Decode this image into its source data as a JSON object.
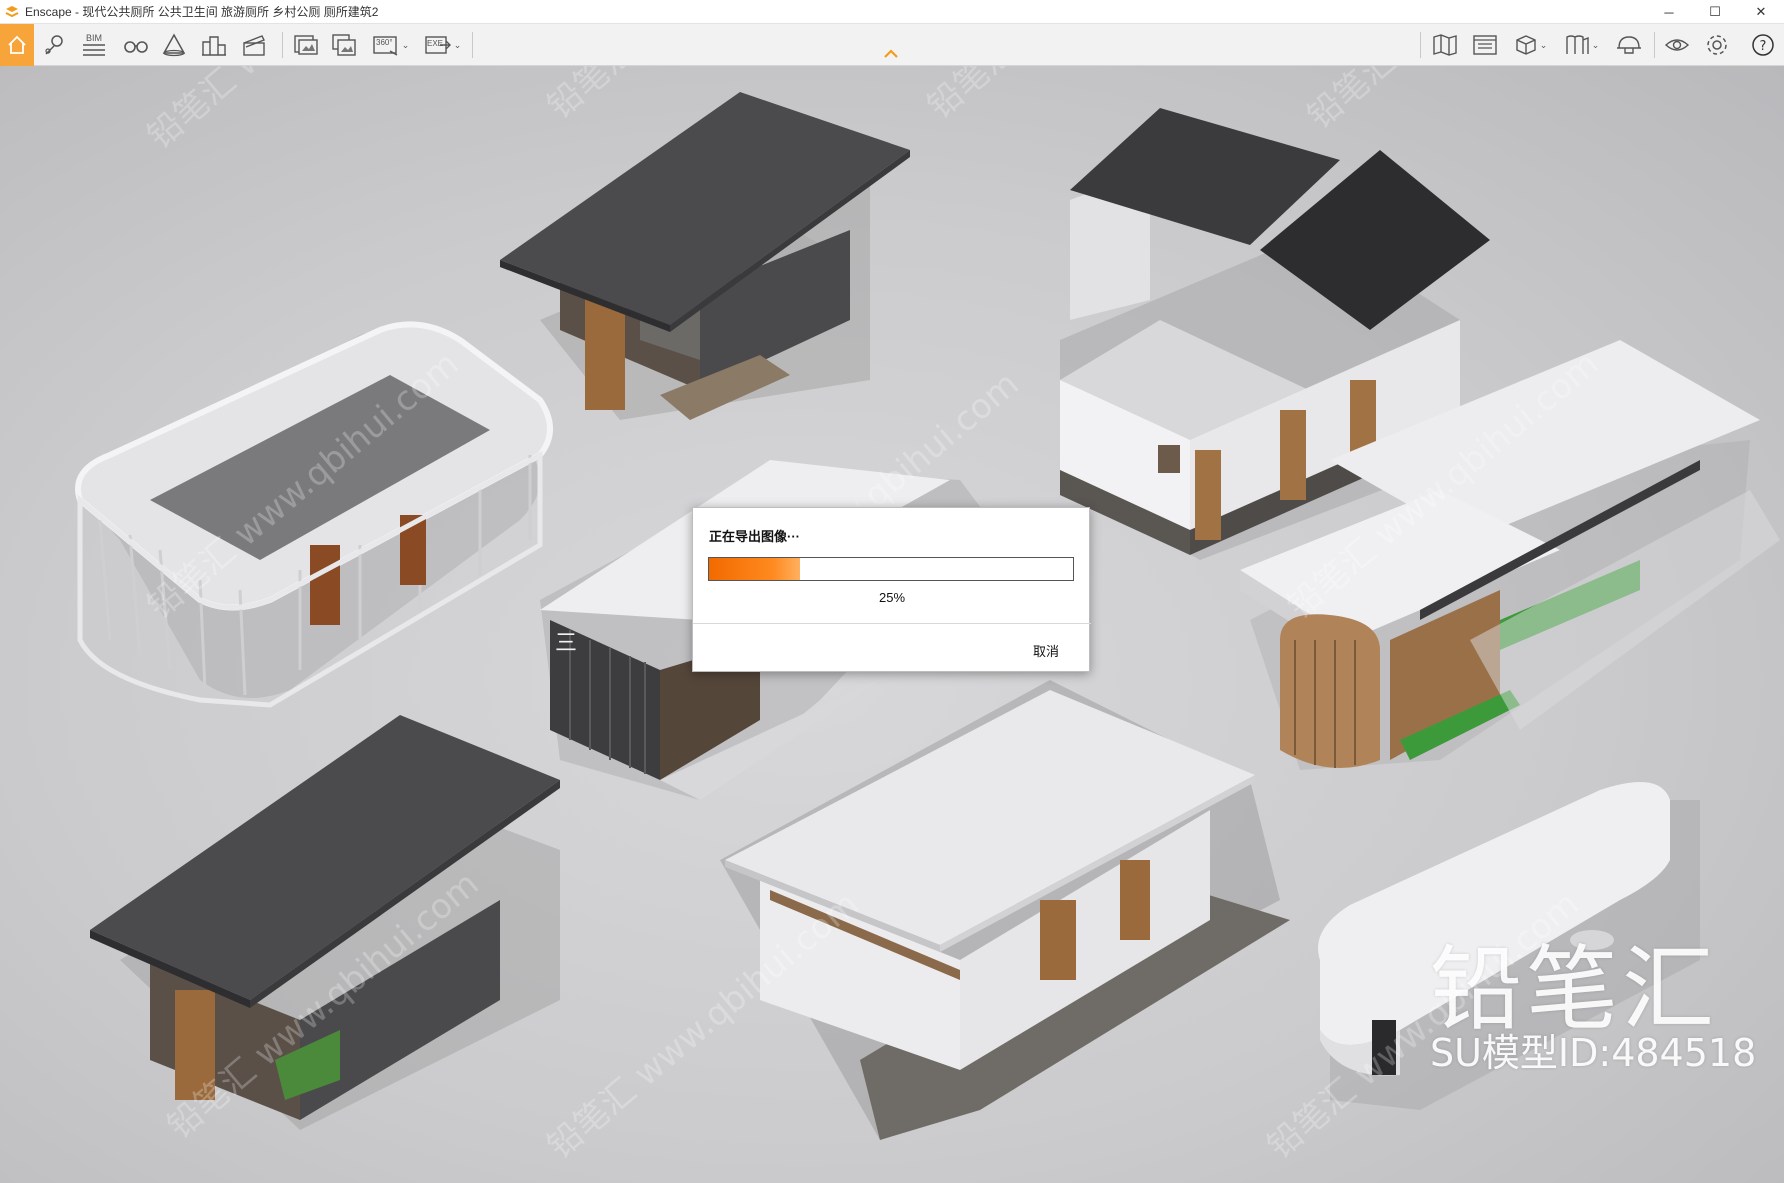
{
  "window": {
    "title": "Enscape - 现代公共厕所 公共卫生间 旅游厕所 乡村公厕 厕所建筑2",
    "minimize_symbol": "─",
    "maximize_symbol": "☐",
    "close_symbol": "✕"
  },
  "toolbar": {
    "bim_label": "BIM",
    "panorama_label": "360°",
    "exe_label": "EXE",
    "accent_color": "#f7a53a",
    "left_tools": [
      "home-icon",
      "location-icon",
      "bim-icon",
      "binoculars-icon",
      "cone-icon",
      "city-icon",
      "clapper-icon",
      "screenshot-icon",
      "batch-render-icon",
      "panorama-icon",
      "exe-export-icon"
    ],
    "right_tools": [
      "map-icon",
      "window-icon",
      "box-icon",
      "bookmarks-icon",
      "helmet-icon",
      "eye-icon",
      "settings-icon",
      "help-icon"
    ]
  },
  "watermark": {
    "brand": "铅笔汇",
    "model_id": "SU模型ID:484518"
  },
  "dialog": {
    "title": "正在导出图像···",
    "progress": 0.25,
    "progress_text": "25%",
    "cancel_label": "取消",
    "progress_color": "#f26a00"
  }
}
